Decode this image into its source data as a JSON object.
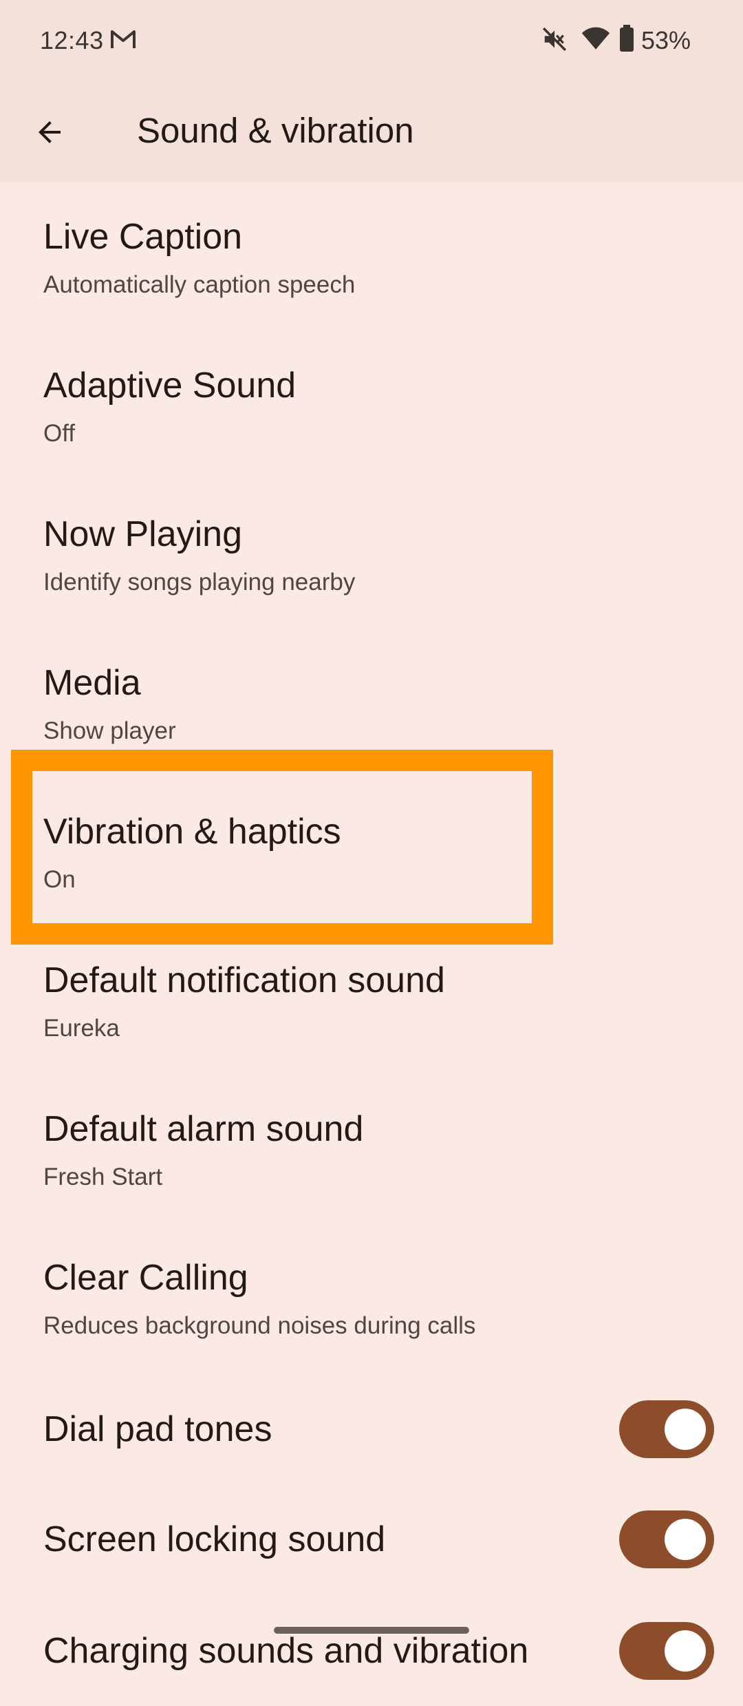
{
  "status_bar": {
    "time": "12:43",
    "battery": "53%",
    "icons": [
      "gmail-icon",
      "mute-icon",
      "wifi-icon",
      "battery-icon"
    ]
  },
  "header": {
    "title": "Sound & vibration",
    "back_icon": "arrow-back-icon"
  },
  "items": [
    {
      "title": "Live Caption",
      "subtitle": "Automatically caption speech"
    },
    {
      "title": "Adaptive Sound",
      "subtitle": "Off"
    },
    {
      "title": "Now Playing",
      "subtitle": "Identify songs playing nearby"
    },
    {
      "title": "Media",
      "subtitle": "Show player"
    },
    {
      "title": "Vibration & haptics",
      "subtitle": "On"
    },
    {
      "title": "Default notification sound",
      "subtitle": "Eureka"
    },
    {
      "title": "Default alarm sound",
      "subtitle": "Fresh Start"
    },
    {
      "title": "Clear Calling",
      "subtitle": "Reduces background noises during calls"
    }
  ],
  "toggles": [
    {
      "title": "Dial pad tones",
      "on": true
    },
    {
      "title": "Screen locking sound",
      "on": true
    },
    {
      "title": "Charging sounds and vibration",
      "on": true
    }
  ],
  "colors": {
    "background": "#fbe9e4",
    "header": "#f4e1da",
    "switch_on": "#8e4d2a",
    "highlight": "#ff9500"
  }
}
